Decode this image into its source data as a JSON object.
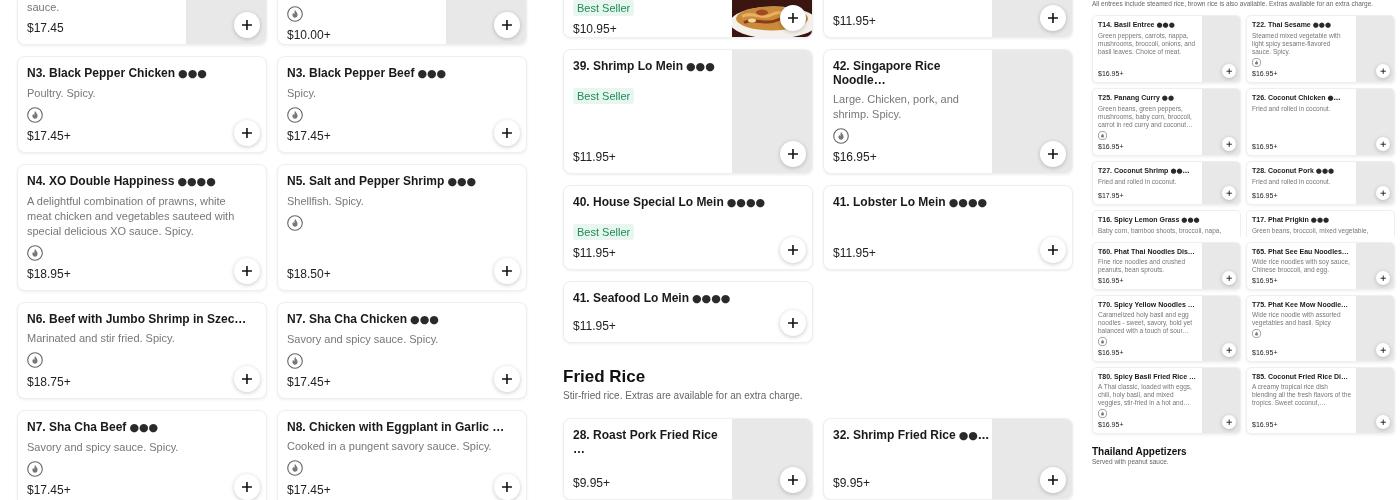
{
  "panes": [
    {
      "sections": [
        {
          "cards": [
            {
              "kind": "placeholder",
              "description": "sauce.",
              "price": "$17.45",
              "spicy_icon": false
            },
            {
              "kind": "placeholder",
              "price": "$10.00+",
              "spicy_icon": true
            },
            {
              "kind": "plain",
              "name": "N3. Black Pepper Chicken",
              "spice": "●●●",
              "description": "Poultry. Spicy.",
              "spicy_icon": true,
              "price": "$17.45+"
            },
            {
              "kind": "plain",
              "name": "N3. Black Pepper Beef",
              "spice": "●●●",
              "description": "Spicy.",
              "spicy_icon": true,
              "price": "$17.45+"
            },
            {
              "kind": "plain",
              "name": "N4. XO Double Happiness",
              "spice": "●●●●",
              "description": "A delightful combination of prawns, white meat chicken and vegetables sauteed with special delicious XO sauce. Spicy.",
              "spicy_icon": true,
              "price": "$18.95+"
            },
            {
              "kind": "plain",
              "name": "N5. Salt and Pepper Shrimp",
              "spice": "●●●",
              "description": "Shellfish. Spicy.",
              "spicy_icon": true,
              "price": "$18.50+"
            },
            {
              "kind": "plain",
              "name": "N6. Beef with Jumbo Shrimp in Szec…",
              "description": "Marinated and stir fried. Spicy.",
              "spicy_icon": true,
              "price": "$18.75+"
            },
            {
              "kind": "plain",
              "name": "N7. Sha Cha Chicken",
              "spice": "●●●",
              "description": "Savory and spicy sauce. Spicy.",
              "spicy_icon": true,
              "price": "$17.45+"
            },
            {
              "kind": "plain",
              "name": "N7. Sha Cha Beef",
              "spice": "●●●",
              "description": "Savory and spicy sauce. Spicy.",
              "spicy_icon": true,
              "price": "$17.45+"
            },
            {
              "kind": "plain",
              "name": "N8. Chicken with Eggplant in Garlic …",
              "description": "Cooked in a pungent savory sauce. Spicy.",
              "spicy_icon": true,
              "price": "$17.45+"
            }
          ]
        }
      ]
    },
    {
      "sections": [
        {
          "cards": [
            {
              "badge": "Best Seller",
              "price": "$10.95+",
              "spicy_icon": false
            },
            {
              "kind": "placeholder",
              "price": "$11.95+",
              "spicy_icon": false
            },
            {
              "kind": "placeholder",
              "name": "39. Shrimp Lo Mein",
              "spice": "●●●",
              "badge": "Best Seller",
              "price": "$11.95+",
              "spicy_icon": false
            },
            {
              "kind": "placeholder",
              "name": "42. Singapore Rice Noodle…",
              "description": "Large. Chicken, pork, and shrimp. Spicy.",
              "spicy_icon": true,
              "price": "$16.95+"
            },
            {
              "kind": "plain",
              "name": "40. House Special Lo Mein",
              "spice": "●●●●",
              "badge": "Best Seller",
              "price": "$11.95+",
              "spicy_icon": false
            },
            {
              "kind": "plain",
              "name": "41. Lobster Lo Mein",
              "spice": "●●●●",
              "price": "$11.95+",
              "spicy_icon": false
            },
            {
              "kind": "plain",
              "name": "41. Seafood Lo Mein",
              "spice": "●●●●",
              "price": "$11.95+",
              "spicy_icon": false
            }
          ]
        },
        {
          "heading": "Fried Rice",
          "description": "Stir-fried rice. Extras are available for an extra charge.",
          "cards": [
            {
              "kind": "placeholder",
              "name": "28. Roast Pork Fried Rice …",
              "price": "$9.95+",
              "spicy_icon": false
            },
            {
              "kind": "placeholder",
              "name": "32. Shrimp Fried Rice",
              "spice": "●●…",
              "price": "$9.95+",
              "spicy_icon": false
            }
          ]
        }
      ]
    },
    {
      "sections": [
        {
          "description": "All entrees include steamed rice, brown rice is also available. Extras available for an extra charge.",
          "cards": [
            {
              "kind": "placeholder",
              "name": "T14. Basil Entree",
              "spice": "●●●",
              "description": "Green peppers, carrots, nappa, mushrooms, broccoli, onions, and basil leaves. Choice of meat.",
              "spicy_icon": false,
              "price": "$16.95+"
            },
            {
              "kind": "placeholder",
              "name": "T22. Thai Sesame",
              "spice": "●●●",
              "description": "Steamed mixed vegetable with light spicy sesame-flavored sauce. Spicy.",
              "spicy_icon": true,
              "price": "$16.95+"
            },
            {
              "kind": "placeholder",
              "name": "T25. Panang Curry",
              "spice": "●●",
              "description": "Green beans, green peppers, mushrooms, baby corn, broccoli, carrot in red curry and coconut…",
              "spicy_icon": true,
              "price": "$16.95+"
            },
            {
              "kind": "placeholder",
              "name": "T26. Coconut Chicken",
              "spice": "●…",
              "description": "Fried and rolled in coconut.",
              "spicy_icon": false,
              "price": "$16.95+"
            },
            {
              "kind": "placeholder",
              "name": "T27. Coconut Shrimp",
              "spice": "●●…",
              "description": "Fried and rolled in coconut.",
              "spicy_icon": false,
              "price": "$17.95+"
            },
            {
              "kind": "placeholder",
              "name": "T28. Coconut Pork",
              "spice": "●●●",
              "description": "Fried and rolled in coconut.",
              "spicy_icon": false,
              "price": "$16.95+"
            },
            {
              "kind": "plain",
              "name": "T16. Spicy Lemon Grass",
              "spice": "●●●",
              "description": "Baby corn, bamboo shoots, broccoli, napa,",
              "spicy_icon": false
            },
            {
              "kind": "plain",
              "name": "T17. Phat Prigkin",
              "spice": "●●●",
              "description": "Green beans, broccoli, mixed vegetable,",
              "spicy_icon": false
            },
            {
              "kind": "placeholder",
              "name": "T60. Phat Thai Noodles Dis…",
              "description": "Fine rice noodles and crushed peanuts, bean sprouts.",
              "spicy_icon": false,
              "price": "$16.95+"
            },
            {
              "kind": "placeholder",
              "name": "T65. Phat See Eau Noodles…",
              "description": "Wide rice noodles with soy sauce, Chinese broccoli, and egg.",
              "spicy_icon": false,
              "price": "$16.95+"
            },
            {
              "kind": "placeholder",
              "name": "T70. Spicy Yellow Noodles …",
              "description": "Caramelized holy basil and egg noodles - sweet, savory, bold yet balanced with a touch of sour…",
              "spicy_icon": true,
              "price": "$16.95+"
            },
            {
              "kind": "placeholder",
              "name": "T75. Phat Kee Mow Noodle…",
              "description": "Wide rice noodle with assorted vegetables and basil. Spicy",
              "spicy_icon": true,
              "price": "$16.95+"
            },
            {
              "kind": "placeholder",
              "name": "T80. Spicy Basil Fried Rice …",
              "description": "A Thai classic, loaded with eggs, chili, holy basil, and mixed veggies, stir-fried in a hot and…",
              "spicy_icon": true,
              "price": "$16.95+"
            },
            {
              "kind": "placeholder",
              "name": "T85. Coconut Fried Rice Di…",
              "description": "A creamy tropical rice dish blending all the fresh flavors of the tropics. Sweet coconut,…",
              "spicy_icon": false,
              "price": "$16.95+"
            }
          ]
        },
        {
          "heading": "Thailand Appetizers",
          "description": "Served with peanut sauce."
        }
      ]
    }
  ]
}
